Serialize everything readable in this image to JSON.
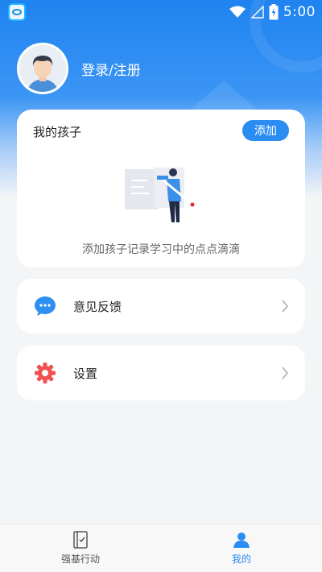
{
  "status_bar": {
    "time": "5:00"
  },
  "profile": {
    "login_label": "登录/注册"
  },
  "child_card": {
    "title": "我的孩子",
    "add_label": "添加",
    "hint": "添加孩子记录学习中的点点滴滴"
  },
  "menu": [
    {
      "label": "意见反馈",
      "icon": "feedback-chat-icon"
    },
    {
      "label": "设置",
      "icon": "settings-gear-icon"
    }
  ],
  "bottom_nav": {
    "tabs": [
      {
        "label": "强基行动",
        "active": false,
        "icon": "notebook-icon"
      },
      {
        "label": "我的",
        "active": true,
        "icon": "person-icon"
      }
    ]
  },
  "colors": {
    "accent": "#2b8cf2",
    "header_top": "#1f83f0",
    "background": "#f4f5f7"
  }
}
